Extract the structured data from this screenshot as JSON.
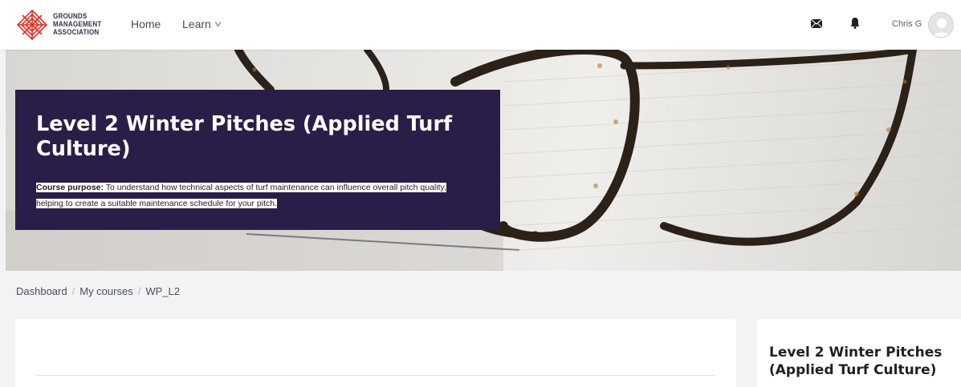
{
  "brand": {
    "line1": "GROUNDS",
    "line2": "MANAGEMENT",
    "line3": "ASSOCIATION",
    "colors": {
      "red": "#d9342b",
      "navy": "#3a2f4a"
    }
  },
  "nav": {
    "home_label": "Home",
    "learn_label": "Learn",
    "learn_chevron": "∨"
  },
  "user": {
    "name": "Chris G",
    "icons": [
      "envelope-icon",
      "bell-icon",
      "avatar"
    ]
  },
  "hero": {
    "title": "Level 2 Winter Pitches (Applied Turf Culture)",
    "purpose_label": "Course purpose:",
    "purpose_text": " To understand how technical aspects of turf maintenance can influence overall pitch quality, helping to create a suitable maintenance schedule for your pitch.",
    "box_color": "#2a1e48"
  },
  "breadcrumb": {
    "items": [
      "Dashboard",
      "My courses",
      "WP_L2"
    ],
    "separator": "/"
  },
  "sidebar": {
    "title": "Level 2 Winter Pitches (Applied Turf Culture)"
  }
}
